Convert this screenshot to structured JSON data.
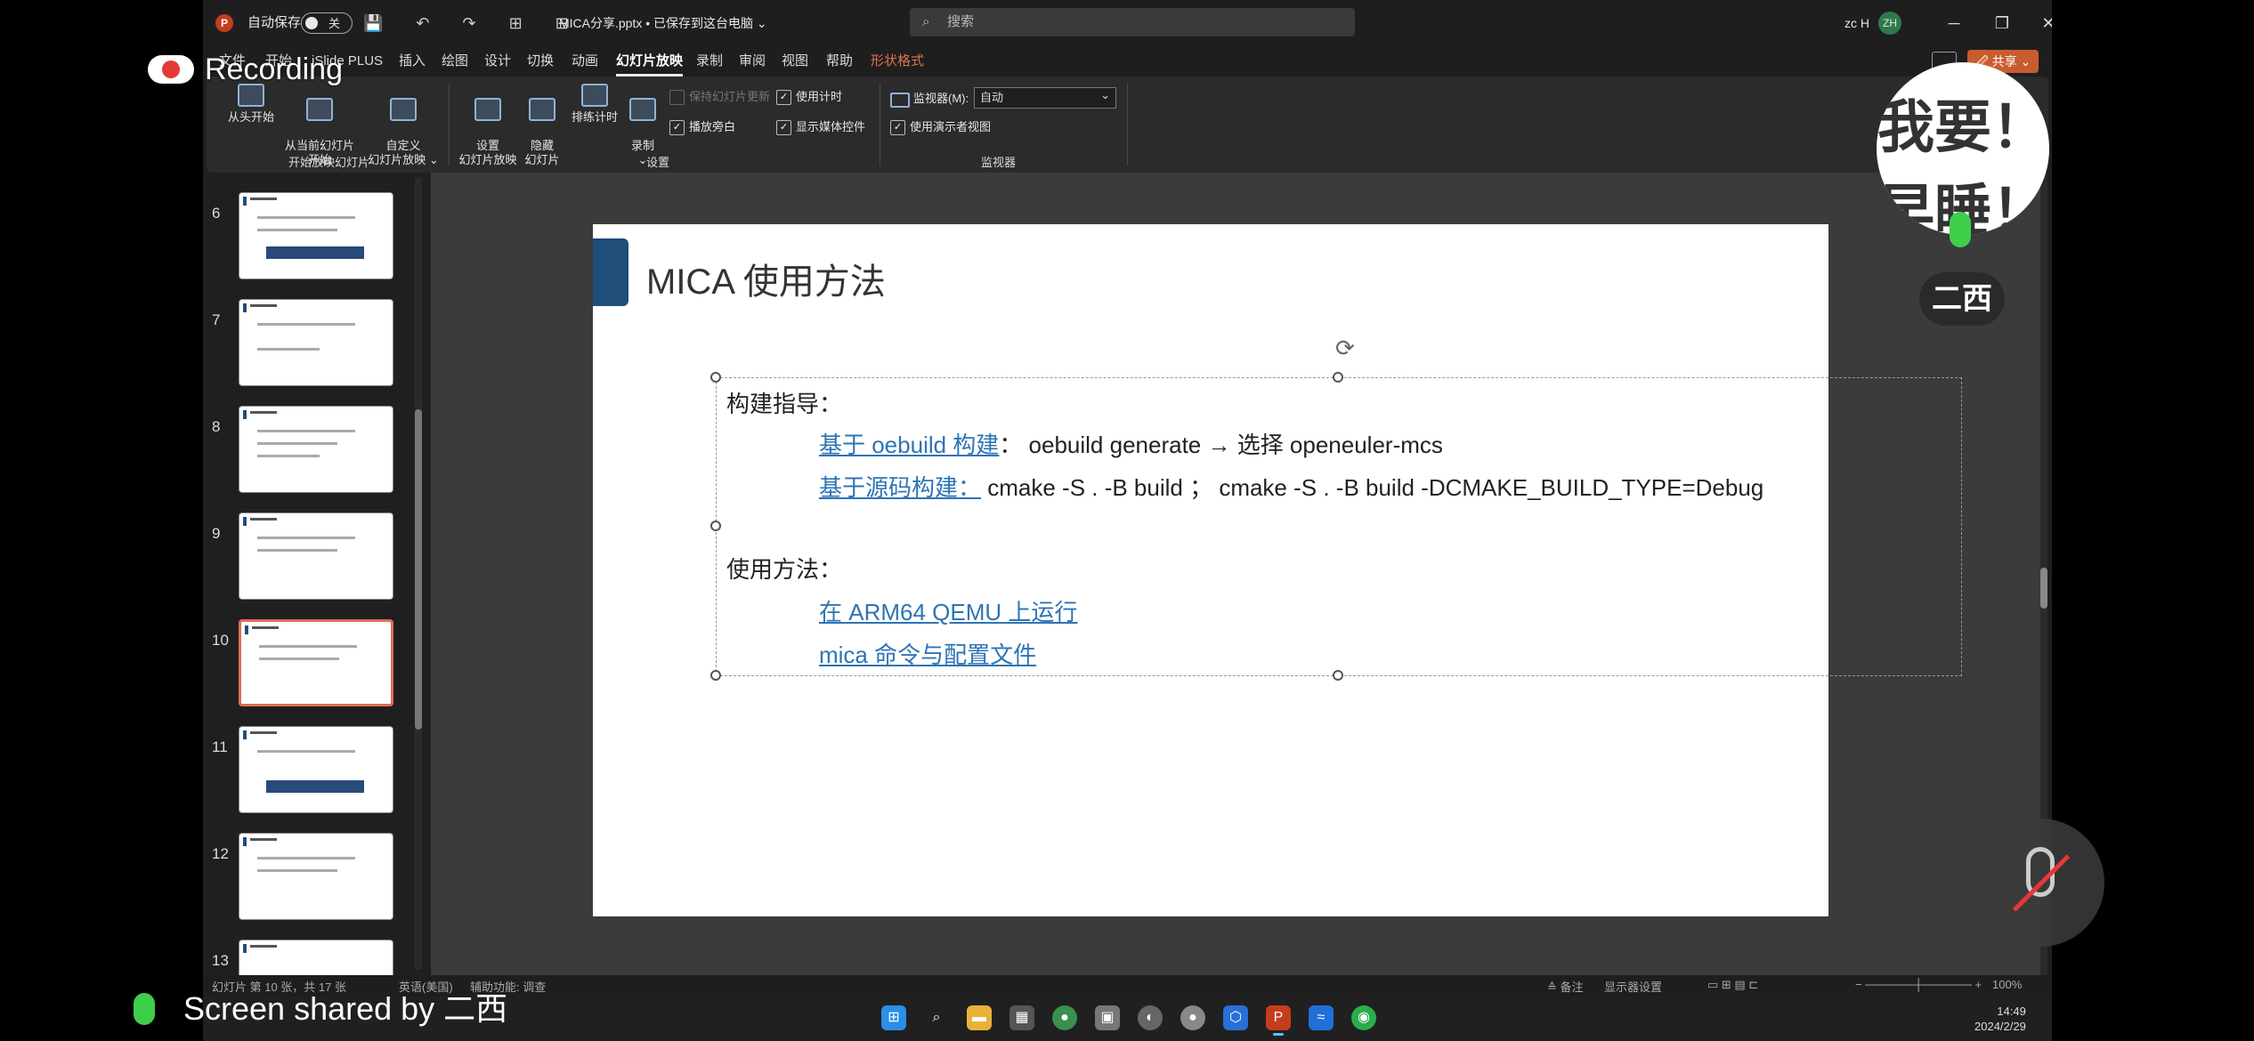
{
  "window": {
    "autosave_label": "自动保存",
    "autosave_state": "关",
    "qat_icons": "💾 ↶ ↷ ⊞ ⊟",
    "doc_title": "MICA分享.pptx • 已保存到这台电脑 ⌄",
    "search_placeholder": "搜索",
    "search_icon": "⌕",
    "user_name": "zc H",
    "user_initials": "ZH",
    "min": "─",
    "max": "❐",
    "close": "✕"
  },
  "tabs": [
    "文件",
    "开始",
    "iSlide PLUS",
    "插入",
    "绘图",
    "设计",
    "切换",
    "动画",
    "幻灯片放映",
    "录制",
    "审阅",
    "视图",
    "帮助",
    "形状格式"
  ],
  "share_label": "🖉 共享 ⌄",
  "ribbon": {
    "from_start": "从头开始",
    "from_current": "从当前幻灯片\n开始",
    "custom_show": "自定义\n幻灯片放映 ⌄",
    "group_start": "开始放映幻灯片",
    "setup_show": "设置\n幻灯片放映",
    "hide_slide": "隐藏\n幻灯片",
    "rehearse": "排练计时",
    "record": "录制\n⌄",
    "keep_updated": "保持幻灯片更新",
    "play_narration": "播放旁白",
    "use_timings": "使用计时",
    "show_media_controls": "显示媒体控件",
    "group_setup": "设置",
    "monitor_label": "监视器(M):",
    "monitor_value": "自动",
    "presenter_view": "使用演示者视图",
    "group_monitor": "监视器"
  },
  "thumbnails": [
    {
      "num": "6"
    },
    {
      "num": "7"
    },
    {
      "num": "8"
    },
    {
      "num": "9"
    },
    {
      "num": "10"
    },
    {
      "num": "11"
    },
    {
      "num": "12"
    },
    {
      "num": "13"
    }
  ],
  "slide": {
    "title": "MICA 使用方法",
    "build_heading": "构建指导：",
    "line1_link": "基于 oebuild 构建",
    "line1_rest": "： oebuild generate → 选择 openeuler-mcs",
    "line2_link": "基于源码构建：",
    "line2_rest": " cmake -S . -B build ；  cmake -S . -B build -DCMAKE_BUILD_TYPE=Debug",
    "usage_heading": "使用方法：",
    "usage_link1": "在 ARM64 QEMU 上运行",
    "usage_link2": "mica 命令与配置文件"
  },
  "statusbar": {
    "slide_info": "幻灯片 第 10 张，共 17 张",
    "language": "英语(美国)",
    "accessibility": "辅助功能: 调查",
    "notes": "≙ 备注",
    "display_settings": "显示器设置",
    "zoom": "100%"
  },
  "taskbar": {
    "time": "14:49",
    "date": "2024/2/29"
  },
  "overlay": {
    "recording": "Recording",
    "shared_by": "Screen shared by 二西",
    "avatar_line1": "我要！",
    "avatar_line2": "早睡！",
    "participant_name": "二西"
  }
}
